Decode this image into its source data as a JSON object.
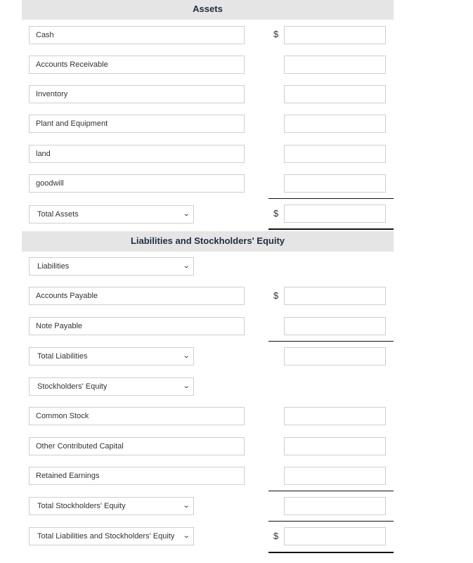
{
  "assets_header": "Assets",
  "liab_header": "Liabilities and Stockholders' Equity",
  "currency": "$",
  "assets": [
    {
      "label": "Cash",
      "amount": ""
    },
    {
      "label": "Accounts Receivable",
      "amount": ""
    },
    {
      "label": "Inventory",
      "amount": ""
    },
    {
      "label": "Plant and Equipment",
      "amount": ""
    },
    {
      "label": "land",
      "amount": ""
    },
    {
      "label": "goodwill",
      "amount": ""
    }
  ],
  "total_assets": {
    "label": "Total Assets",
    "amount": ""
  },
  "liabilities_select": "Liabilities",
  "liabilities": [
    {
      "label": "Accounts Payable",
      "amount": ""
    },
    {
      "label": "Note Payable",
      "amount": ""
    }
  ],
  "total_liabilities": {
    "label": "Total Liabilities",
    "amount": ""
  },
  "equity_select": "Stockholders' Equity",
  "equity": [
    {
      "label": "Common Stock",
      "amount": ""
    },
    {
      "label": "Other Contributed Capital",
      "amount": ""
    },
    {
      "label": "Retained Earnings",
      "amount": ""
    }
  ],
  "total_equity": {
    "label": "Total Stockholders' Equity",
    "amount": ""
  },
  "total_le": {
    "label": "Total Liabilities and Stockholders' Equity",
    "amount": ""
  }
}
